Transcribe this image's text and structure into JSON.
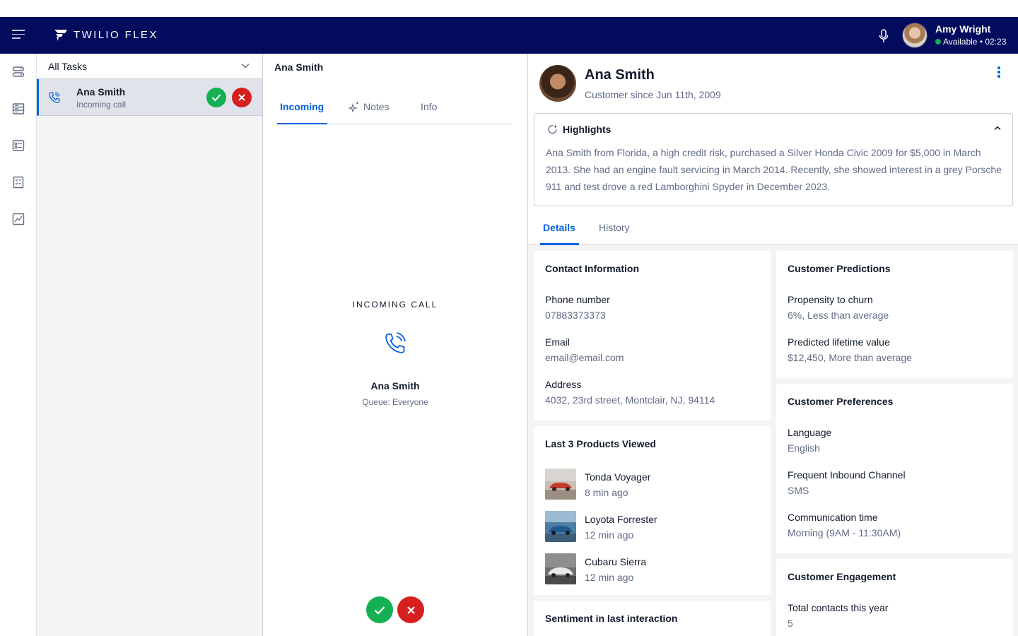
{
  "header": {
    "brand": "TWILIO FLEX",
    "agent_name": "Amy Wright",
    "agent_status": "Available • 02:23",
    "agent_status_color": "#14b053"
  },
  "sidenav": {
    "icons": [
      "queues-icon",
      "agent-desktop-icon",
      "teams-icon",
      "tasks-icon",
      "analytics-icon"
    ]
  },
  "tasklist": {
    "filter_label": "All Tasks",
    "task": {
      "name": "Ana Smith",
      "status": "Incoming call"
    }
  },
  "task_panel": {
    "title": "Ana Smith",
    "tabs": [
      "Incoming",
      "Notes",
      "Info"
    ],
    "incoming_label": "INCOMING CALL",
    "caller_name": "Ana Smith",
    "queue": "Queue: Everyone"
  },
  "customer": {
    "name": "Ana Smith",
    "since": "Customer since Jun 11th, 2009",
    "highlights_title": "Highlights",
    "highlights_text": "Ana Smith from Florida, a high credit risk, purchased a Silver Honda Civic 2009 for $5,000 in March 2013. She had an engine fault servicing in March 2014. Recently, she showed interest in a grey Porsche 911 and test drove a red Lamborghini Spyder in December 2023.",
    "tabs": [
      "Details",
      "History"
    ]
  },
  "contact": {
    "title": "Contact Information",
    "phone_label": "Phone number",
    "phone": "07883373373",
    "email_label": "Email",
    "email": "email@email.com",
    "address_label": "Address",
    "address": "4032, 23rd street, Montclair, NJ, 94114"
  },
  "products": {
    "title": "Last 3 Products Viewed",
    "items": [
      {
        "name": "Tonda Voyager",
        "time": "8 min ago"
      },
      {
        "name": "Loyota Forrester",
        "time": "12 min ago"
      },
      {
        "name": "Cubaru Sierra",
        "time": "12 min ago"
      }
    ]
  },
  "sentiment": {
    "title": "Sentiment in last interaction"
  },
  "predictions": {
    "title": "Customer Predictions",
    "churn_label": "Propensity to churn",
    "churn_value": "6%, Less than average",
    "ltv_label": "Predicted lifetime value",
    "ltv_value": "$12,450, More than average"
  },
  "preferences": {
    "title": "Customer Preferences",
    "language_label": "Language",
    "language": "English",
    "channel_label": "Frequent Inbound Channel",
    "channel": "SMS",
    "time_label": "Communication time",
    "time": "Morning (9AM - 11:30AM)"
  },
  "engagement": {
    "title": "Customer Engagement",
    "contacts_label": "Total contacts this year",
    "contacts": "5"
  },
  "colors": {
    "topbar": "#030b5d",
    "accent": "#0263e0",
    "accept": "#14b053",
    "decline": "#d61f1f"
  }
}
